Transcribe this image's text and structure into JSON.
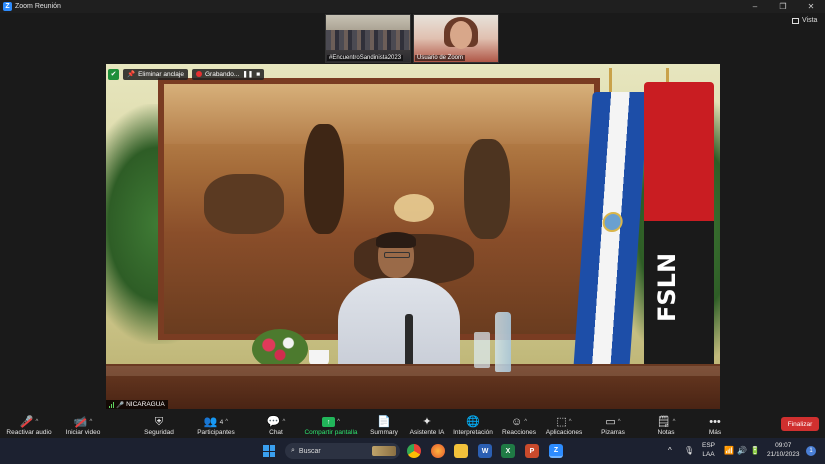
{
  "window": {
    "title": "Zoom Reunión",
    "controls": [
      "–",
      "❐",
      "✕"
    ]
  },
  "view_button": {
    "label": "Vista"
  },
  "thumbnails": [
    {
      "label": "#EncuentroSandinista2023"
    },
    {
      "label": "Usuario de Zoom"
    }
  ],
  "pin_bar": {
    "unpin_label": "Eliminar anclaje",
    "recording_label": "Grabando..."
  },
  "speaker": {
    "name": "NICARAGUA"
  },
  "toolbar": {
    "audio": "Reactivar audio",
    "video": "Iniciar video",
    "security": "Seguridad",
    "participants": "Participantes",
    "participants_count": "4",
    "chat": "Chat",
    "share": "Compartir pantalla",
    "summary": "Summary",
    "ai": "Asistente IA",
    "interpretation": "Interpretación",
    "reactions": "Reacciones",
    "apps": "Aplicaciones",
    "whiteboards": "Pizarras",
    "notes": "Notas",
    "more": "Más",
    "end": "Finalizar"
  },
  "taskbar": {
    "search_placeholder": "Buscar",
    "lang_top": "ESP",
    "lang_bottom": "LAA",
    "time": "09:07",
    "date": "21/10/2023",
    "notifications": "1"
  },
  "colors": {
    "share_green": "#21b65a",
    "end_red": "#d0302f",
    "zoom_blue": "#2d8cff"
  }
}
